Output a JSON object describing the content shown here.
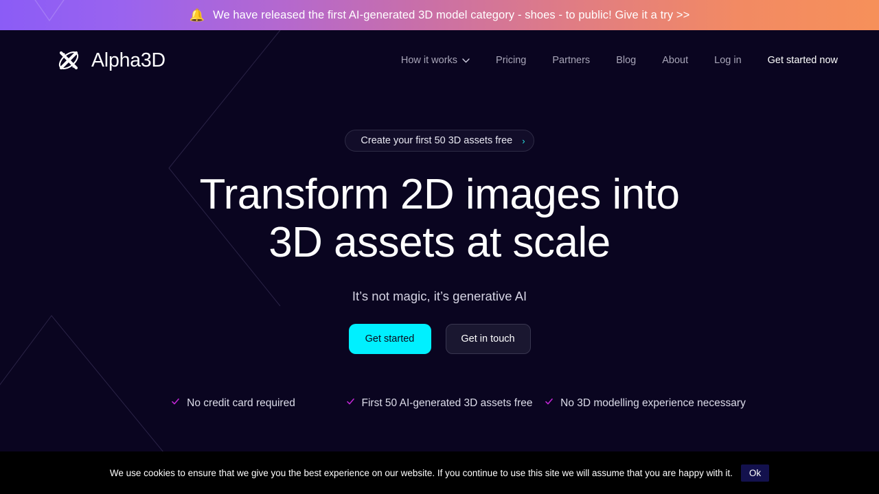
{
  "theme": {
    "background": "#0a0520",
    "accent_cyan": "#00f0ff",
    "accent_magenta": "#c026d3",
    "banner_gradient_start": "#8b5cf6",
    "banner_gradient_mid": "#c96fa8",
    "banner_gradient_end": "#f6905a"
  },
  "announcement": {
    "icon": "bell-icon",
    "bell_glyph": "🔔",
    "text": "We have released the first AI-generated 3D model category - shoes - to public! Give it a try >>"
  },
  "header": {
    "logo": {
      "icon": "atom-logo-icon",
      "wordmark": "Alpha3D"
    },
    "nav": [
      {
        "label": "How it works",
        "has_dropdown": true
      },
      {
        "label": "Pricing",
        "has_dropdown": false
      },
      {
        "label": "Partners",
        "has_dropdown": false
      },
      {
        "label": "Blog",
        "has_dropdown": false
      },
      {
        "label": "About",
        "has_dropdown": false
      },
      {
        "label": "Log in",
        "has_dropdown": false
      },
      {
        "label": "Get started now",
        "has_dropdown": false
      }
    ]
  },
  "hero": {
    "pill": {
      "label": "Create your first 50 3D assets free",
      "arrow": "›"
    },
    "headline_line1": "Transform 2D images into",
    "headline_line2": "3D assets at scale",
    "subheadline": "It’s not magic, it’s generative AI",
    "primary_cta": "Get started",
    "secondary_cta": "Get in touch",
    "features": [
      "No credit card required",
      "First 50 AI-generated 3D assets free",
      "No 3D modelling experience necessary"
    ]
  },
  "cookie_notice": {
    "text": "We use cookies to ensure that we give you the best experience on our website. If you continue to use this site we will assume that you are happy with it.",
    "accept_label": "Ok"
  }
}
